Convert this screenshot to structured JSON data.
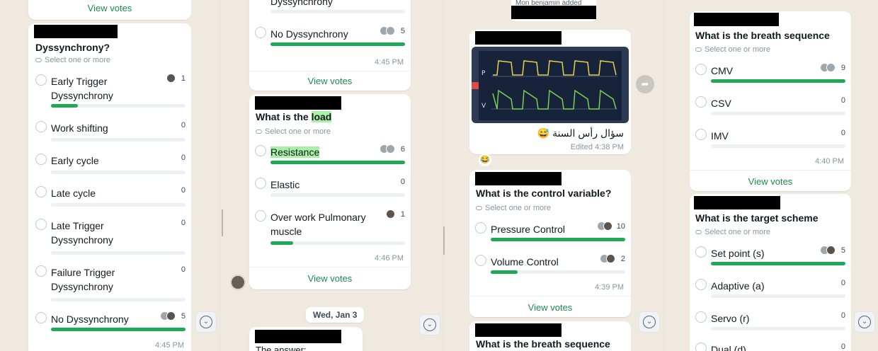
{
  "colors": {
    "accent": "#1fa855",
    "link": "#1a8a52",
    "chat_bg": "#efe9df",
    "bubble": "#ffffff"
  },
  "common": {
    "select_hint": "Select one or more",
    "view_votes": "View votes"
  },
  "panel1": {
    "top_view_votes": "View votes",
    "poll": {
      "title": "Dyssynchrony?",
      "options": [
        {
          "label": "Early Trigger Dyssynchrony",
          "count": "1",
          "fill": 0.2
        },
        {
          "label": "Work shifting",
          "count": "0",
          "fill": 0
        },
        {
          "label": "Early cycle",
          "count": "0",
          "fill": 0
        },
        {
          "label": "Late cycle",
          "count": "0",
          "fill": 0
        },
        {
          "label": "Late Trigger Dyssynchrony",
          "count": "0",
          "fill": 0
        },
        {
          "label": "Failure Trigger Dyssynchrony",
          "count": "0",
          "fill": 0
        },
        {
          "label": "No Dyssynchrony",
          "count": "5",
          "fill": 1.0
        }
      ],
      "time": "4:45 PM"
    }
  },
  "panel2": {
    "poll_top": {
      "partial_label": "Dyssynchrony",
      "option": {
        "label": "No Dyssynchrony",
        "count": "5",
        "fill": 1.0
      },
      "time": "4:45 PM",
      "view_votes": "View votes"
    },
    "poll": {
      "title_prefix": "What is the ",
      "title_highlight": "load",
      "options": [
        {
          "label": "Resistance",
          "count": "6",
          "fill": 1.0
        },
        {
          "label": "Elastic",
          "count": "0",
          "fill": 0
        },
        {
          "label": "Over work Pulmonary muscle",
          "count": "1",
          "fill": 0.17
        }
      ],
      "time": "4:46 PM",
      "view_votes": "View votes"
    },
    "date": "Wed, Jan 3",
    "answer_text": "The answer:"
  },
  "panel3": {
    "system_msg": "Mon benjamin added",
    "image_msg": {
      "caption": "سؤال رأس السنة 😅",
      "edited": "Edited 4:38 PM",
      "reaction": "😂",
      "vent_label_p": "P",
      "vent_label_v": "V"
    },
    "poll": {
      "title": "What is the control variable?",
      "options": [
        {
          "label": "Pressure Control",
          "count": "10",
          "fill": 1.0
        },
        {
          "label": "Volume Control",
          "count": "2",
          "fill": 0.2
        }
      ],
      "time": "4:39 PM",
      "view_votes": "View votes"
    },
    "next_title": "What is the breath sequence"
  },
  "panel4": {
    "poll1": {
      "title": "What is the breath sequence",
      "options": [
        {
          "label": "CMV",
          "count": "9",
          "fill": 1.0
        },
        {
          "label": "CSV",
          "count": "0",
          "fill": 0
        },
        {
          "label": "IMV",
          "count": "0",
          "fill": 0
        }
      ],
      "time": "4:40 PM",
      "view_votes": "View votes"
    },
    "poll2": {
      "title": "What is the target scheme",
      "options": [
        {
          "label": "Set point (s)",
          "count": "5",
          "fill": 1.0
        },
        {
          "label": "Adaptive (a)",
          "count": "0",
          "fill": 0
        },
        {
          "label": "Servo (r)",
          "count": "0",
          "fill": 0
        },
        {
          "label": "Dual (d)",
          "count": "0",
          "fill": 0
        }
      ]
    }
  },
  "icons": {
    "scroll_down": "chevron-down-icon",
    "forward": "forward-icon",
    "poll_select": "double-check-icon"
  }
}
